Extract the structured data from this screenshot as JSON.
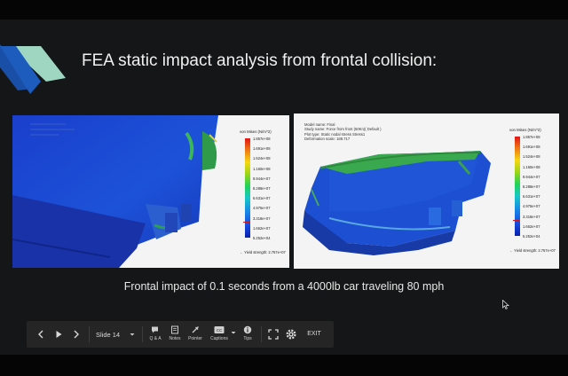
{
  "slide": {
    "title": "FEA static impact analysis from frontal collision:",
    "caption": "Frontal impact of 0.1 seconds  from a 4000lb car traveling 80 mph",
    "colors": {
      "background": "#151617",
      "accent_blue": "#1a4fa8",
      "accent_teal": "#9fd6c2"
    }
  },
  "left_image": {
    "legend": {
      "title": "von Mises (N/m^2)",
      "ticks": [
        "1.857e+08",
        "1.691e+08",
        "1.524e+08",
        "1.160e+08",
        "9.944e+07",
        "8.288e+07",
        "6.631e+07",
        "4.975e+07",
        "3.318e+07",
        "1.662e+07",
        "5.252e+04"
      ],
      "yield": "Yield strength: 2.757e+07"
    }
  },
  "right_image": {
    "info": [
      "Model name: Final",
      "Study name: Force from front (50Kn)( Default )",
      "Plot type: Static nodal stress Stress1",
      "Deformation scale: 188.717"
    ],
    "legend": {
      "title": "von Mises (N/m^2)",
      "ticks": [
        "1.857e+08",
        "1.691e+08",
        "1.524e+08",
        "1.160e+08",
        "9.944e+07",
        "8.288e+07",
        "6.631e+07",
        "4.975e+07",
        "3.318e+07",
        "1.662e+07",
        "5.252e+04"
      ],
      "yield": "Yield strength: 2.757e+07"
    }
  },
  "toolbar": {
    "prev_icon": "chevron-left-icon",
    "play_icon": "play-icon",
    "next_icon": "chevron-right-icon",
    "slide_label": "Slide 14",
    "qa_label": "Q & A",
    "notes_label": "Notes",
    "pointer_label": "Pointer",
    "captions_label": "Captions",
    "tips_label": "Tips",
    "exit_label": "EXIT"
  }
}
